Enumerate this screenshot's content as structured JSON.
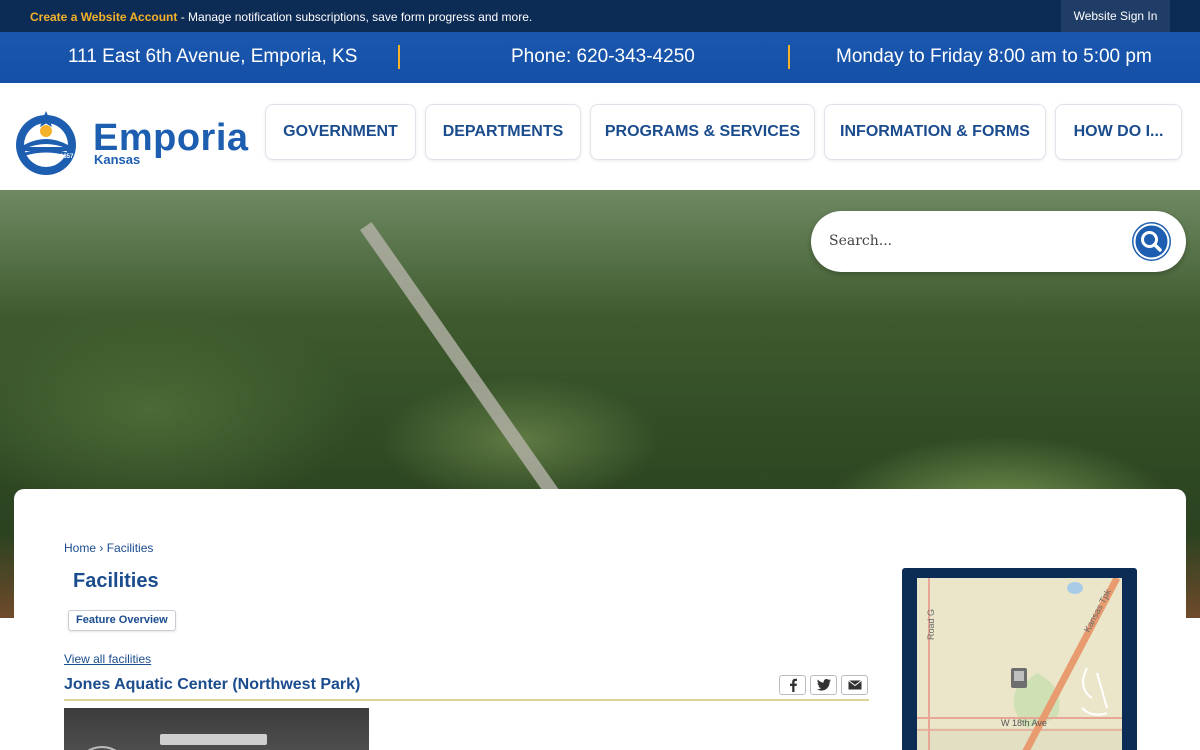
{
  "topbar": {
    "create_link": "Create a Website Account",
    "message": " - Manage notification subscriptions, save form progress and more.",
    "signin_label": "Website Sign In"
  },
  "contact": {
    "address": "111 East 6th Avenue, Emporia, KS",
    "phone": "Phone: 620-343-4250",
    "hours": "Monday to Friday 8:00 am to 5:00 pm"
  },
  "logo": {
    "name": "Emporia",
    "state": "Kansas",
    "year": "1857"
  },
  "nav": [
    {
      "label": "GOVERNMENT"
    },
    {
      "label": "DEPARTMENTS"
    },
    {
      "label": "PROGRAMS & SERVICES"
    },
    {
      "label": "INFORMATION & FORMS"
    },
    {
      "label": "HOW DO I..."
    }
  ],
  "search": {
    "placeholder": "Search...",
    "icon": "search-icon"
  },
  "breadcrumb": {
    "home": "Home",
    "separator": "›",
    "current": "Facilities"
  },
  "page": {
    "title": "Facilities",
    "feature_overview": "Feature Overview",
    "view_all": "View all facilities",
    "facility_name": "Jones Aquatic Center (Northwest Park)"
  },
  "share": [
    {
      "icon": "facebook-icon"
    },
    {
      "icon": "twitter-icon"
    },
    {
      "icon": "email-icon"
    }
  ],
  "map": {
    "road_g": "Road G",
    "kansas_tpk": "Kansas Tpk",
    "street": "W 18th Ave"
  },
  "colors": {
    "topbar": "#0c2b55",
    "contactbar": "#1450a6",
    "accent": "#f3b22a",
    "brand": "#1d5eb0",
    "link": "#1a4c8e"
  }
}
